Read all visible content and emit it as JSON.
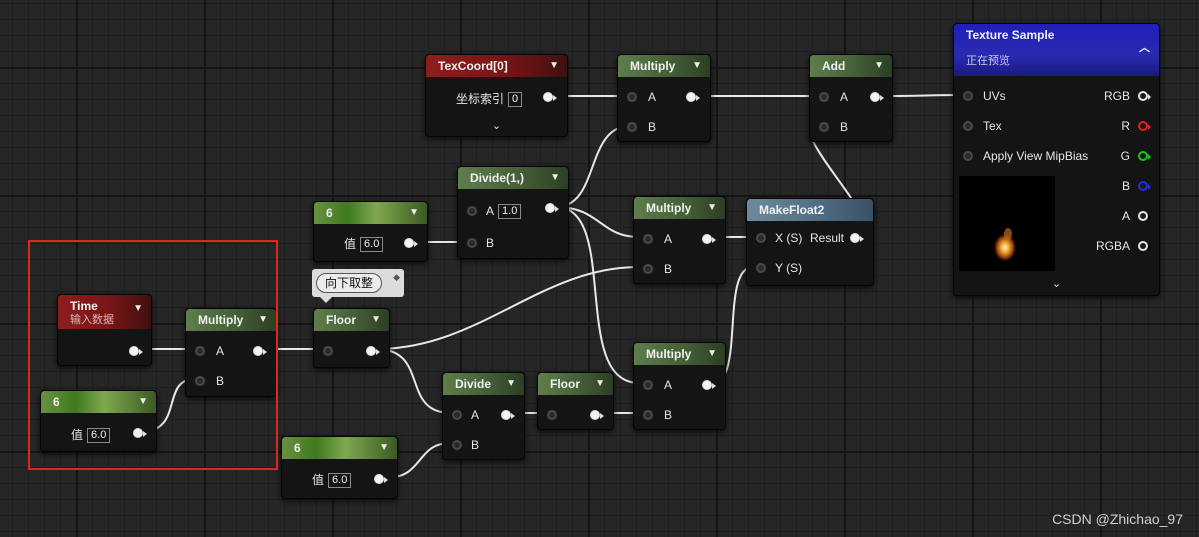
{
  "nodes": {
    "texcoord": {
      "title": "TexCoord[0]",
      "row_label": "坐标索引",
      "value": "0"
    },
    "multiply_top": {
      "title": "Multiply",
      "pin_a": "A",
      "pin_b": "B"
    },
    "add": {
      "title": "Add",
      "pin_a": "A",
      "pin_b": "B"
    },
    "texture_sample": {
      "title": "Texture Sample",
      "subtitle": "正在预览",
      "inputs": [
        "UVs",
        "Tex",
        "Apply View MipBias"
      ],
      "outputs": [
        "RGB",
        "R",
        "G",
        "B",
        "A",
        "RGBA"
      ]
    },
    "divide_const": {
      "title": "Divide(1,)",
      "pin_a": "A",
      "value": "1.0",
      "pin_b": "B"
    },
    "const6_top": {
      "title": "6",
      "row_label": "值",
      "value": "6.0"
    },
    "multiply_mid": {
      "title": "Multiply",
      "pin_a": "A",
      "pin_b": "B"
    },
    "makefloat2": {
      "title": "MakeFloat2",
      "pin_x": "X (S)",
      "pin_y": "Y (S)",
      "output": "Result"
    },
    "tooltip": {
      "label": "向下取整"
    },
    "time": {
      "title": "Time",
      "subtitle": "输入数据"
    },
    "multiply_left": {
      "title": "Multiply",
      "pin_a": "A",
      "pin_b": "B"
    },
    "floor_top": {
      "title": "Floor"
    },
    "const6_left": {
      "title": "6",
      "row_label": "值",
      "value": "6.0"
    },
    "multiply_bottom": {
      "title": "Multiply",
      "pin_a": "A",
      "pin_b": "B"
    },
    "divide": {
      "title": "Divide",
      "pin_a": "A",
      "pin_b": "B"
    },
    "floor_bottom": {
      "title": "Floor"
    },
    "const6_bottom": {
      "title": "6",
      "row_label": "值",
      "value": "6.0"
    }
  },
  "colors": {
    "selection_border": "#e0261e",
    "pin_r": "#e02020",
    "pin_g": "#20c020",
    "pin_b": "#2030e0"
  },
  "watermark": "CSDN @Zhichao_97"
}
